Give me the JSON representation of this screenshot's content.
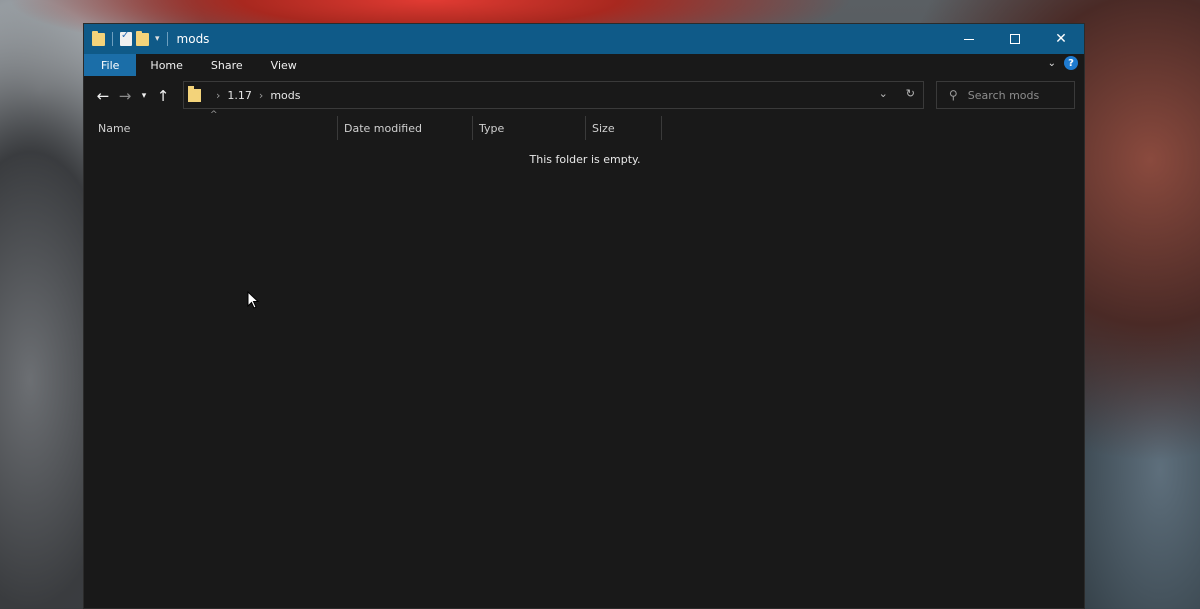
{
  "window": {
    "title": "mods",
    "caption": {
      "minimize": "",
      "maximize": "",
      "close": "✕"
    }
  },
  "ribbon": {
    "tabs": [
      {
        "label": "File",
        "active": true
      },
      {
        "label": "Home"
      },
      {
        "label": "Share"
      },
      {
        "label": "View"
      }
    ],
    "help_label": "?"
  },
  "address_bar": {
    "breadcrumbs": [
      "1.17",
      "mods"
    ],
    "separator": "›"
  },
  "search": {
    "placeholder": "Search mods"
  },
  "columns": [
    "Name",
    "Date modified",
    "Type",
    "Size"
  ],
  "content": {
    "empty_message": "This folder is empty."
  },
  "colors": {
    "titlebar": "#0f5a88",
    "file_tab": "#1b6ea8",
    "window_bg": "#191919",
    "folder": "#f3d37a"
  },
  "icons": {
    "back": "arrow-left-icon",
    "forward": "arrow-right-icon",
    "recent": "chevron-down-icon",
    "up": "arrow-up-icon",
    "refresh": "refresh-icon",
    "search": "search-icon"
  }
}
